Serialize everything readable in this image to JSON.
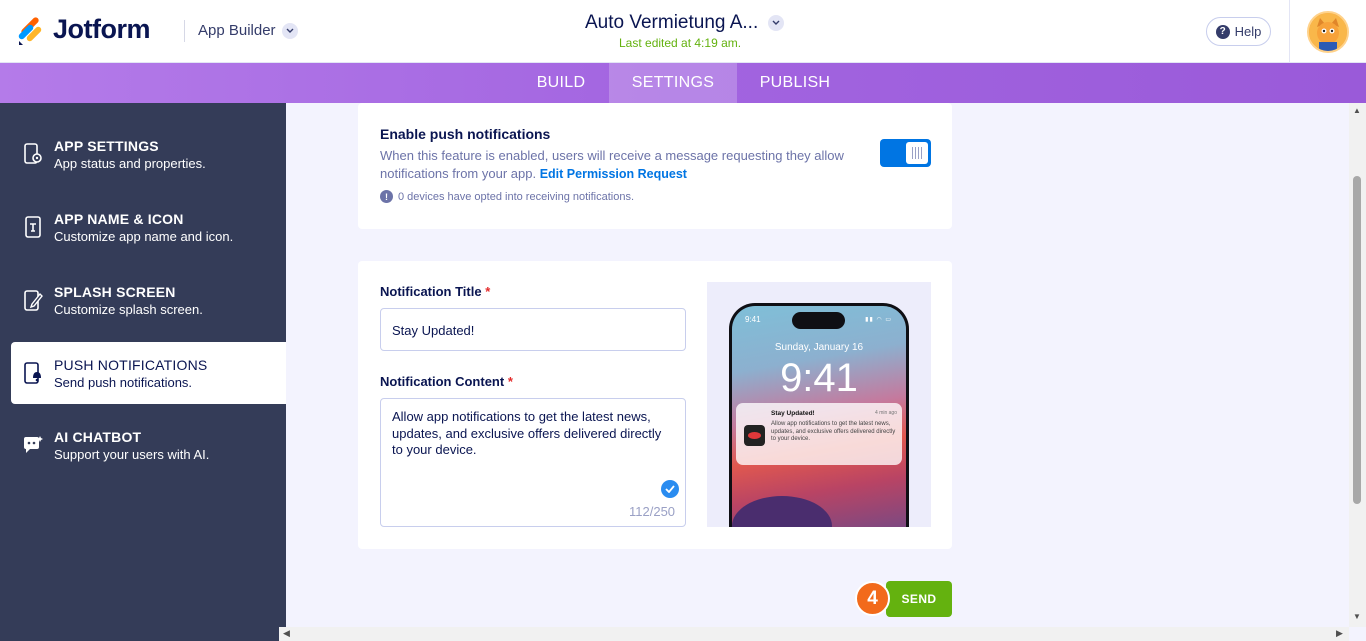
{
  "header": {
    "logo_text": "Jotform",
    "section": "App Builder",
    "app_title": "Auto Vermietung A...",
    "last_edited": "Last edited at 4:19 am.",
    "help_label": "Help"
  },
  "tabs": [
    {
      "label": "BUILD",
      "active": false
    },
    {
      "label": "SETTINGS",
      "active": true
    },
    {
      "label": "PUBLISH",
      "active": false
    }
  ],
  "sidebar": {
    "items": [
      {
        "title": "APP SETTINGS",
        "subtitle": "App status and properties.",
        "icon": "phone-gear-icon"
      },
      {
        "title": "APP NAME & ICON",
        "subtitle": "Customize app name and icon.",
        "icon": "phone-text-icon"
      },
      {
        "title": "SPLASH SCREEN",
        "subtitle": "Customize splash screen.",
        "icon": "phone-pen-icon"
      },
      {
        "title": "PUSH NOTIFICATIONS",
        "subtitle": "Send push notifications.",
        "icon": "phone-bell-icon",
        "active": true
      },
      {
        "title": "AI CHATBOT",
        "subtitle": "Support your users with AI.",
        "icon": "chatbot-icon"
      }
    ]
  },
  "push": {
    "label": "Enable push notifications",
    "description": "When this feature is enabled, users will receive a message requesting they allow notifications from your app.",
    "link": "Edit Permission Request",
    "devices_info": "0 devices have opted into receiving notifications.",
    "enabled": true
  },
  "form": {
    "title_label": "Notification Title",
    "title_value": "Stay Updated!",
    "content_label": "Notification Content",
    "content_value": "Allow app notifications to get the latest news, updates, and exclusive offers delivered directly to your device.",
    "required_mark": "*",
    "counter": "112/250"
  },
  "preview": {
    "status_time": "9:41",
    "date": "Sunday, January 16",
    "clock": "9:41",
    "notif_title": "Stay Updated!",
    "notif_ago": "4 min ago",
    "notif_body": "Allow app notifications to get the latest news, updates, and exclusive offers delivered directly to your device."
  },
  "actions": {
    "send_label": "SEND",
    "step_number": "4"
  },
  "colors": {
    "accent_blue": "#0075e3",
    "send_green": "#64b20f",
    "step_orange": "#f26a1b",
    "sidebar_bg": "#343c58",
    "tabbar_purple": "#a264e0"
  }
}
